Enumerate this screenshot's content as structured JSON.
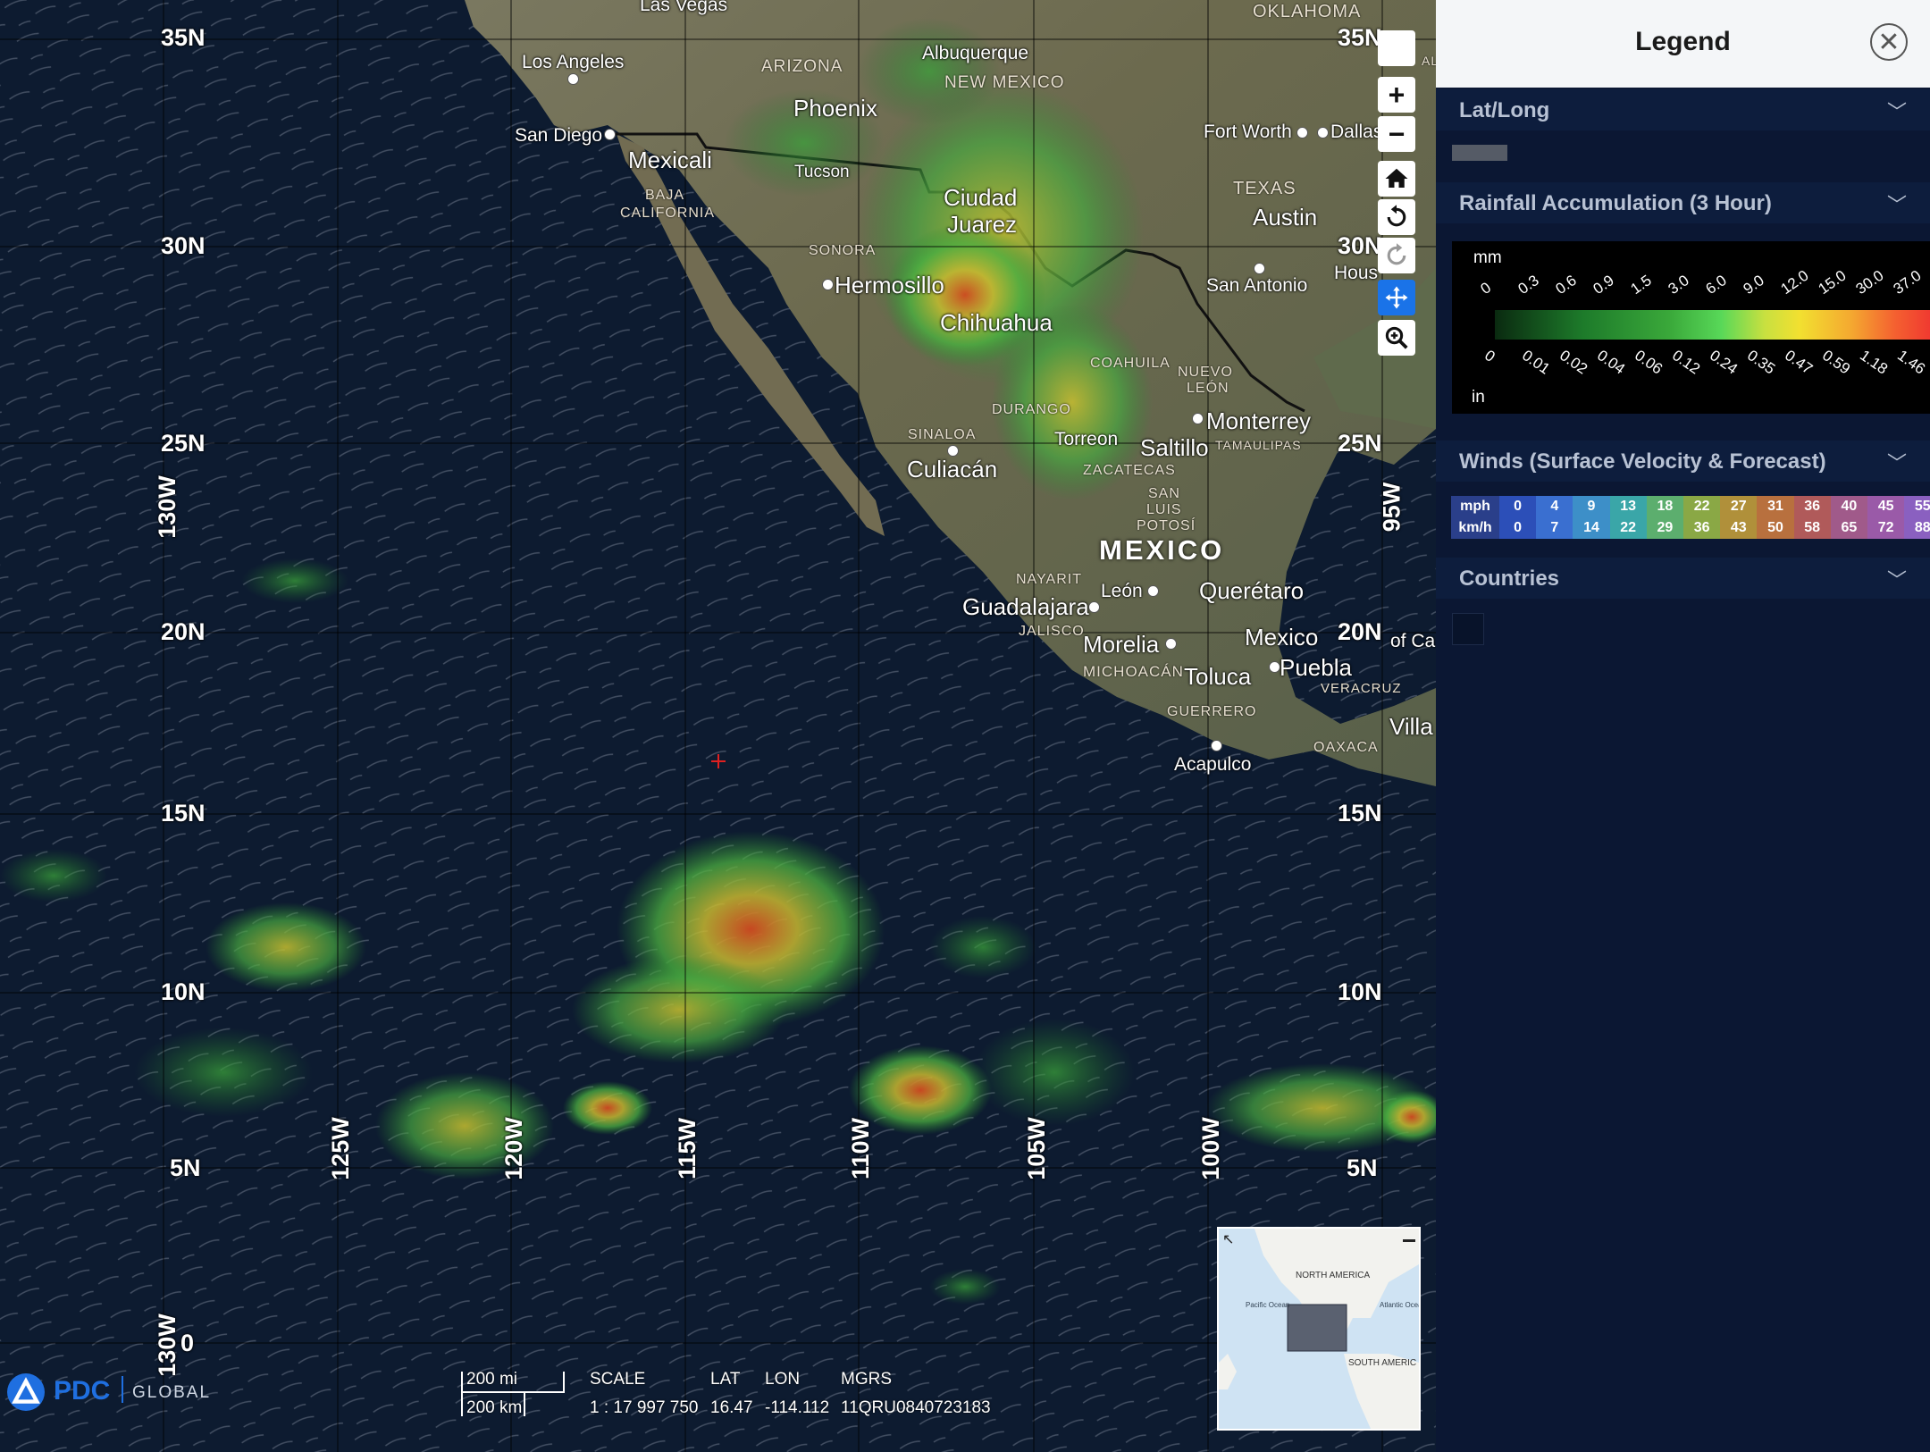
{
  "map": {
    "lat_labels": [
      "35N",
      "30N",
      "25N",
      "20N",
      "15N",
      "10N",
      "5N",
      "0"
    ],
    "lat_labels_right": [
      "35N",
      "30N",
      "25N",
      "20N",
      "15N",
      "10N",
      "5N"
    ],
    "lon_labels": [
      "130W",
      "125W",
      "120W",
      "115W",
      "110W",
      "105W",
      "100W",
      "95W",
      "130W"
    ],
    "cities": [
      "Las Vegas",
      "OKLAHOMA",
      "Los Angeles",
      "ARIZONA",
      "Albuquerque",
      "NEW MEXICO",
      "Phoenix",
      "San Diego",
      "Mexicali",
      "Fort Worth",
      "Dallas",
      "Tucson",
      "BAJA",
      "CALIFORNIA",
      "Ciudad",
      "Juarez",
      "TEXAS",
      "Austin",
      "SONORA",
      "Hermosillo",
      "San Antonio",
      "Hous",
      "Chihuahua",
      "COAHUILA",
      "NUEVO",
      "LEÓN",
      "DURANGO",
      "Monterrey",
      "SINALOA",
      "Torreon",
      "Saltillo",
      "TAMAULIPAS",
      "Culiacán",
      "ZACATECAS",
      "SAN",
      "LUIS",
      "POTOSÍ",
      "MEXICO",
      "NAYARIT",
      "León",
      "Querétaro",
      "Guadalajara",
      "JALISCO",
      "Morelia",
      "Mexico",
      "of Ca",
      "MICHOACÁN",
      "Toluca",
      "Puebla",
      "VERACRUZ",
      "GUERRERO",
      "Villa",
      "OAXACA",
      "Acapulco",
      "AL"
    ],
    "minimap_labels": [
      "NORTH AMERICA",
      "Pacific Ocean",
      "Atlantic Ocean",
      "SOUTH AMERIC"
    ]
  },
  "toolbar": {
    "zoom_in": "+",
    "zoom_out": "−"
  },
  "status": {
    "scale_mi": "200 mi",
    "scale_km": "200 km",
    "scale_label": "SCALE",
    "scale_value": "1 : 17 997 750",
    "lat_label": "LAT",
    "lat_value": "16.47",
    "lon_label": "LON",
    "lon_value": "-114.112",
    "mgrs_label": "MGRS",
    "mgrs_value": "11QRU0840723183",
    "logo_text": "PDC",
    "logo_sub": "GLOBAL"
  },
  "legend": {
    "title": "Legend",
    "sections": [
      "Lat/Long",
      "Rainfall Accumulation (3 Hour)",
      "Winds (Surface Velocity & Forecast)",
      "Countries"
    ],
    "rain_unit_top": "mm",
    "rain_unit_bottom": "in",
    "rain_mm": [
      "0",
      "0.3",
      "0.6",
      "0.9",
      "1.5",
      "3.0",
      "6.0",
      "9.0",
      "12.0",
      "15.0",
      "30.0",
      "37.0"
    ],
    "rain_in": [
      "0",
      "0.01",
      "0.02",
      "0.04",
      "0.06",
      "0.12",
      "0.24",
      "0.35",
      "0.47",
      "0.59",
      "1.18",
      "1.46"
    ],
    "wind_mph_label": "mph",
    "wind_kmh_label": "km/h",
    "wind_mph": [
      "0",
      "4",
      "9",
      "13",
      "18",
      "22",
      "27",
      "31",
      "36",
      "40",
      "45",
      "55"
    ],
    "wind_kmh": [
      "0",
      "7",
      "14",
      "22",
      "29",
      "36",
      "43",
      "50",
      "58",
      "65",
      "72",
      "88"
    ],
    "wind_colors": [
      "#2c4fb8",
      "#3a6fd0",
      "#3d8fc8",
      "#3aa6a8",
      "#5cae6e",
      "#8aa845",
      "#b0903a",
      "#b8703e",
      "#b05a5a",
      "#a05a8a",
      "#9a5aa8",
      "#8a60c0"
    ]
  }
}
